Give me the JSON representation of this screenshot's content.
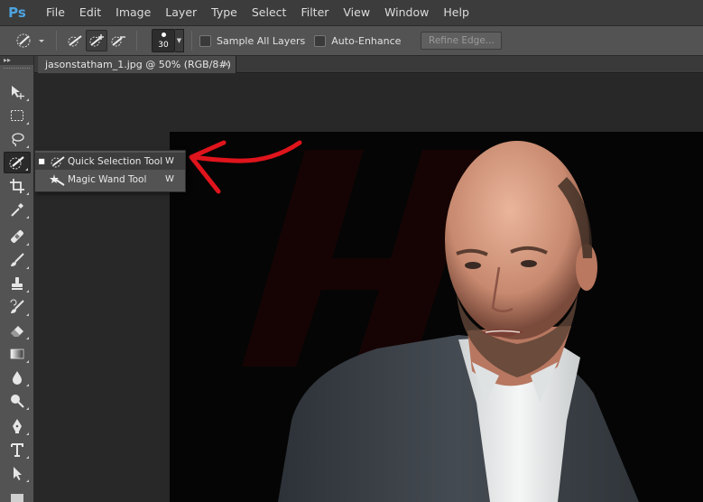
{
  "app": {
    "logo": "Ps"
  },
  "menu": [
    "File",
    "Edit",
    "Image",
    "Layer",
    "Type",
    "Select",
    "Filter",
    "View",
    "Window",
    "Help"
  ],
  "options": {
    "brush_size": "30",
    "sample_all_layers": "Sample All Layers",
    "auto_enhance": "Auto-Enhance",
    "refine_edge": "Refine Edge..."
  },
  "document": {
    "tab_title": "jasonstatham_1.jpg @ 50% (RGB/8#)",
    "close_glyph": "×"
  },
  "flyout": {
    "items": [
      {
        "label": "Quick Selection Tool",
        "shortcut": "W",
        "icon": "quick-selection-icon",
        "selected": true
      },
      {
        "label": "Magic Wand Tool",
        "shortcut": "W",
        "icon": "magic-wand-icon",
        "selected": false
      }
    ]
  },
  "tools": [
    "move-icon",
    "marquee-icon",
    "lasso-icon",
    "quick-selection-icon",
    "crop-icon",
    "eyedropper-icon",
    "healing-brush-icon",
    "brush-icon",
    "clone-stamp-icon",
    "history-brush-icon",
    "eraser-icon",
    "gradient-icon",
    "blur-icon",
    "dodge-icon",
    "pen-icon",
    "type-icon",
    "path-selection-icon",
    "rectangle-icon"
  ],
  "colors": {
    "accent": "#4da3e0",
    "annotation_arrow": "#e0141c"
  }
}
